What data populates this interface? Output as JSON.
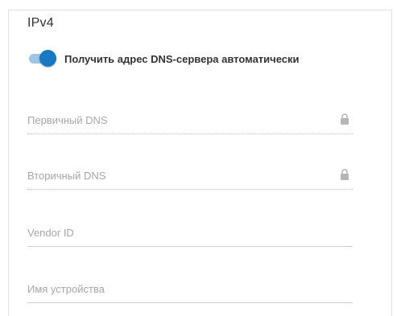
{
  "section": {
    "title": "IPv4"
  },
  "dns_auto": {
    "label": "Получить адрес DNS-сервера автоматически",
    "enabled": true,
    "accent_color": "#1a78c2"
  },
  "fields": {
    "primary_dns": {
      "placeholder": "Первичный DNS",
      "value": "",
      "locked": true,
      "icon": "lock-icon"
    },
    "secondary_dns": {
      "placeholder": "Вторичный DNS",
      "value": "",
      "locked": true,
      "icon": "lock-icon"
    },
    "vendor_id": {
      "placeholder": "Vendor ID",
      "value": ""
    },
    "device_name": {
      "placeholder": "Имя устройства",
      "value": ""
    }
  }
}
